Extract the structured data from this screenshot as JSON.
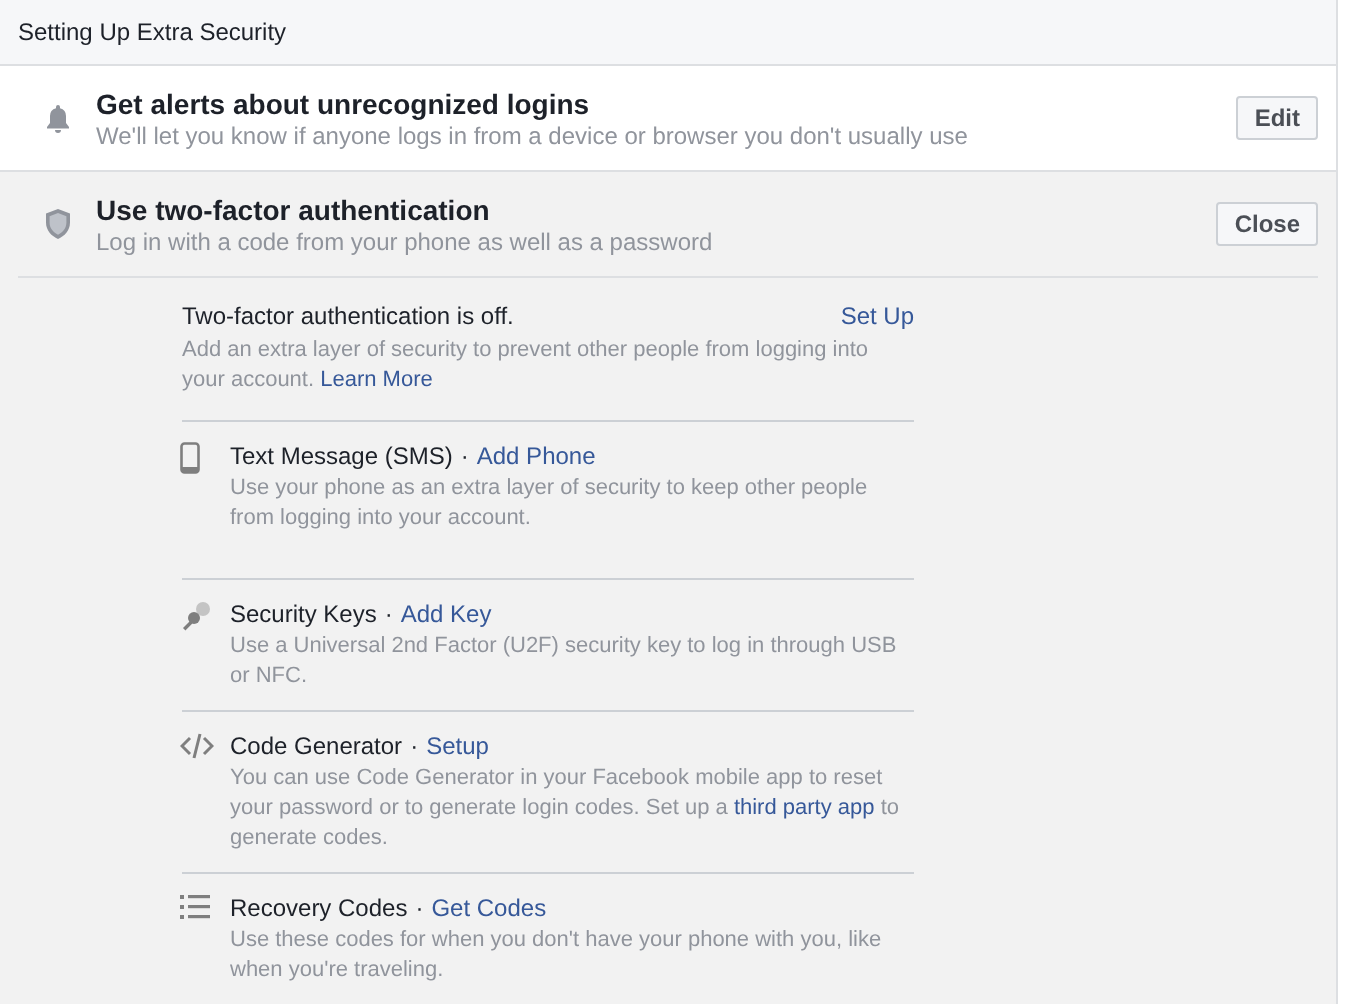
{
  "header": {
    "title": "Setting Up Extra Security"
  },
  "sections": [
    {
      "title": "Get alerts about unrecognized logins",
      "subtitle": "We'll let you know if anyone logs in from a device or browser you don't usually use",
      "button": "Edit",
      "expanded": false
    },
    {
      "title": "Use two-factor authentication",
      "subtitle": "Log in with a code from your phone as well as a password",
      "button": "Close",
      "expanded": true
    }
  ],
  "two_factor": {
    "status": "Two-factor authentication is off.",
    "action": "Set Up",
    "intro": [
      {
        "text": "Add an extra layer of security to prevent other people from logging into your account. ",
        "link": false
      },
      {
        "text": "Learn More",
        "link": true
      }
    ],
    "methods": [
      {
        "name": "Text Message (SMS)",
        "separator": "·",
        "action": "Add Phone",
        "description": [
          {
            "text": "Use your phone as an extra layer of security to keep other people from logging into your account.",
            "link": false
          }
        ]
      },
      {
        "name": "Security Keys",
        "separator": "·",
        "action": "Add Key",
        "description": [
          {
            "text": "Use a Universal 2nd Factor (U2F) security key to log in through USB or NFC.",
            "link": false
          }
        ]
      },
      {
        "name": "Code Generator",
        "separator": "·",
        "action": "Setup",
        "description": [
          {
            "text": "You can use Code Generator in your Facebook mobile app to reset your password or to generate login codes. Set up a ",
            "link": false
          },
          {
            "text": "third party app",
            "link": true
          },
          {
            "text": " to generate codes.",
            "link": false
          }
        ]
      },
      {
        "name": "Recovery Codes",
        "separator": "·",
        "action": "Get Codes",
        "description": [
          {
            "text": "Use these codes for when you don't have your phone with you, like when you're traveling.",
            "link": false
          }
        ]
      }
    ]
  }
}
